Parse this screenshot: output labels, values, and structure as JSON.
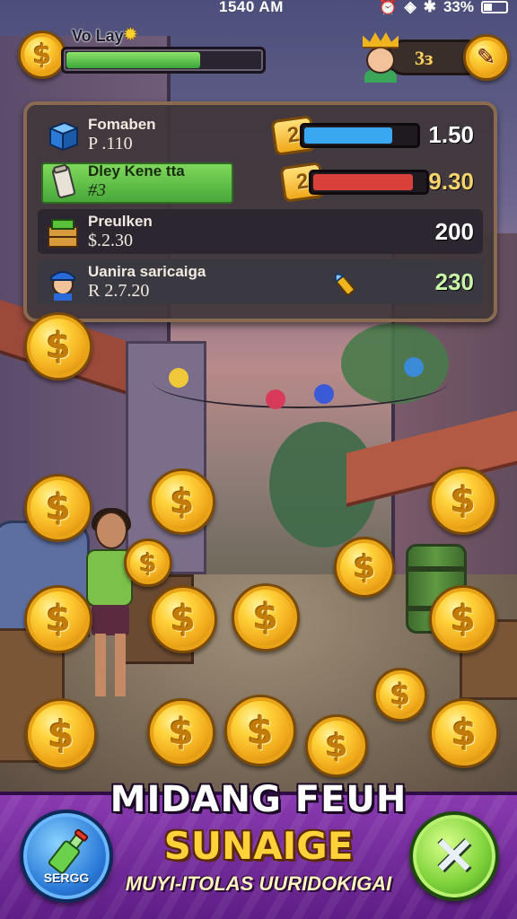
{
  "status_bar": {
    "time": "1540 AM",
    "battery": "33%"
  },
  "hud": {
    "player_name": "Vo Lay",
    "xp_progress": 0.7,
    "currency_value": "3ɜ",
    "star_icon": "star-icon",
    "pencil_icon": "pencil-icon"
  },
  "list": {
    "rows": [
      {
        "title": "Fomaben",
        "subtitle": "P .110",
        "level": "2",
        "progress": 0.8,
        "bar_color": "#39a8f0",
        "value": "1.50",
        "icon": "blue-cube-icon"
      },
      {
        "title": "Dley Kene tta",
        "subtitle": "#3",
        "level": "2",
        "progress": 0.9,
        "bar_color": "#d8403a",
        "value": "9.30",
        "icon": "scroll-icon"
      },
      {
        "title": "Preulken",
        "subtitle": "$.2.30",
        "value": "200",
        "icon": "crate-icon"
      },
      {
        "title": "Uanira saricaiga",
        "subtitle": "R 2.7.20",
        "value": "230",
        "icon": "police-avatar-icon",
        "extra_icon": "bullet-icon"
      }
    ]
  },
  "coin_symbol": "$",
  "banner": {
    "line1": "MIDANG FEUH",
    "line2": "SUNAIGE",
    "line3": "MUYI-ITOLAS UURIDOKIGAI",
    "left_button_label": "SERGG",
    "right_button_icon": "crossed-swords-icon"
  }
}
